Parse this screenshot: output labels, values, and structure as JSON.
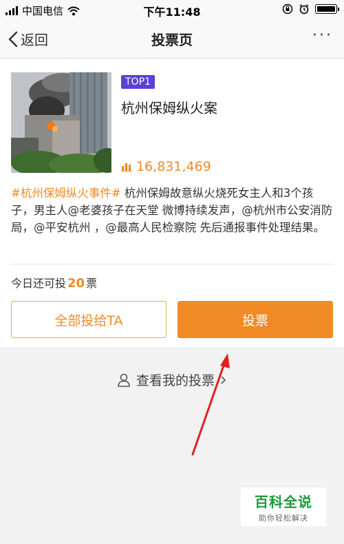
{
  "status_bar": {
    "carrier": "中国电信",
    "time": "下午11:48",
    "battery_level": 0.85
  },
  "nav": {
    "back_label": "返回",
    "title": "投票页",
    "more_label": "···"
  },
  "item": {
    "rank_badge": "TOP1",
    "title": "杭州保姆纵火案",
    "vote_count": "16,831,469",
    "description_tag": "#杭州保姆纵火事件#",
    "description": " 杭州保姆故意纵火烧死女主人和3个孩子，男主人@老婆孩子在天堂 微博持续发声，@杭州市公安消防局，@平安杭州 ，@最高人民检察院 先后通报事件处理结果。"
  },
  "voting": {
    "remaining_prefix": "今日还可投",
    "remaining_count": "20",
    "remaining_suffix": "票",
    "all_button": "全部投给TA",
    "vote_button": "投票"
  },
  "my_votes_link": "查看我的投票",
  "watermark": {
    "brand": "百科全说",
    "slogan": "助你轻松解决"
  },
  "colors": {
    "accent": "#f08a24",
    "badge": "#5b3fd6",
    "arrow": "#e02020",
    "watermark": "#1a9a3a"
  }
}
